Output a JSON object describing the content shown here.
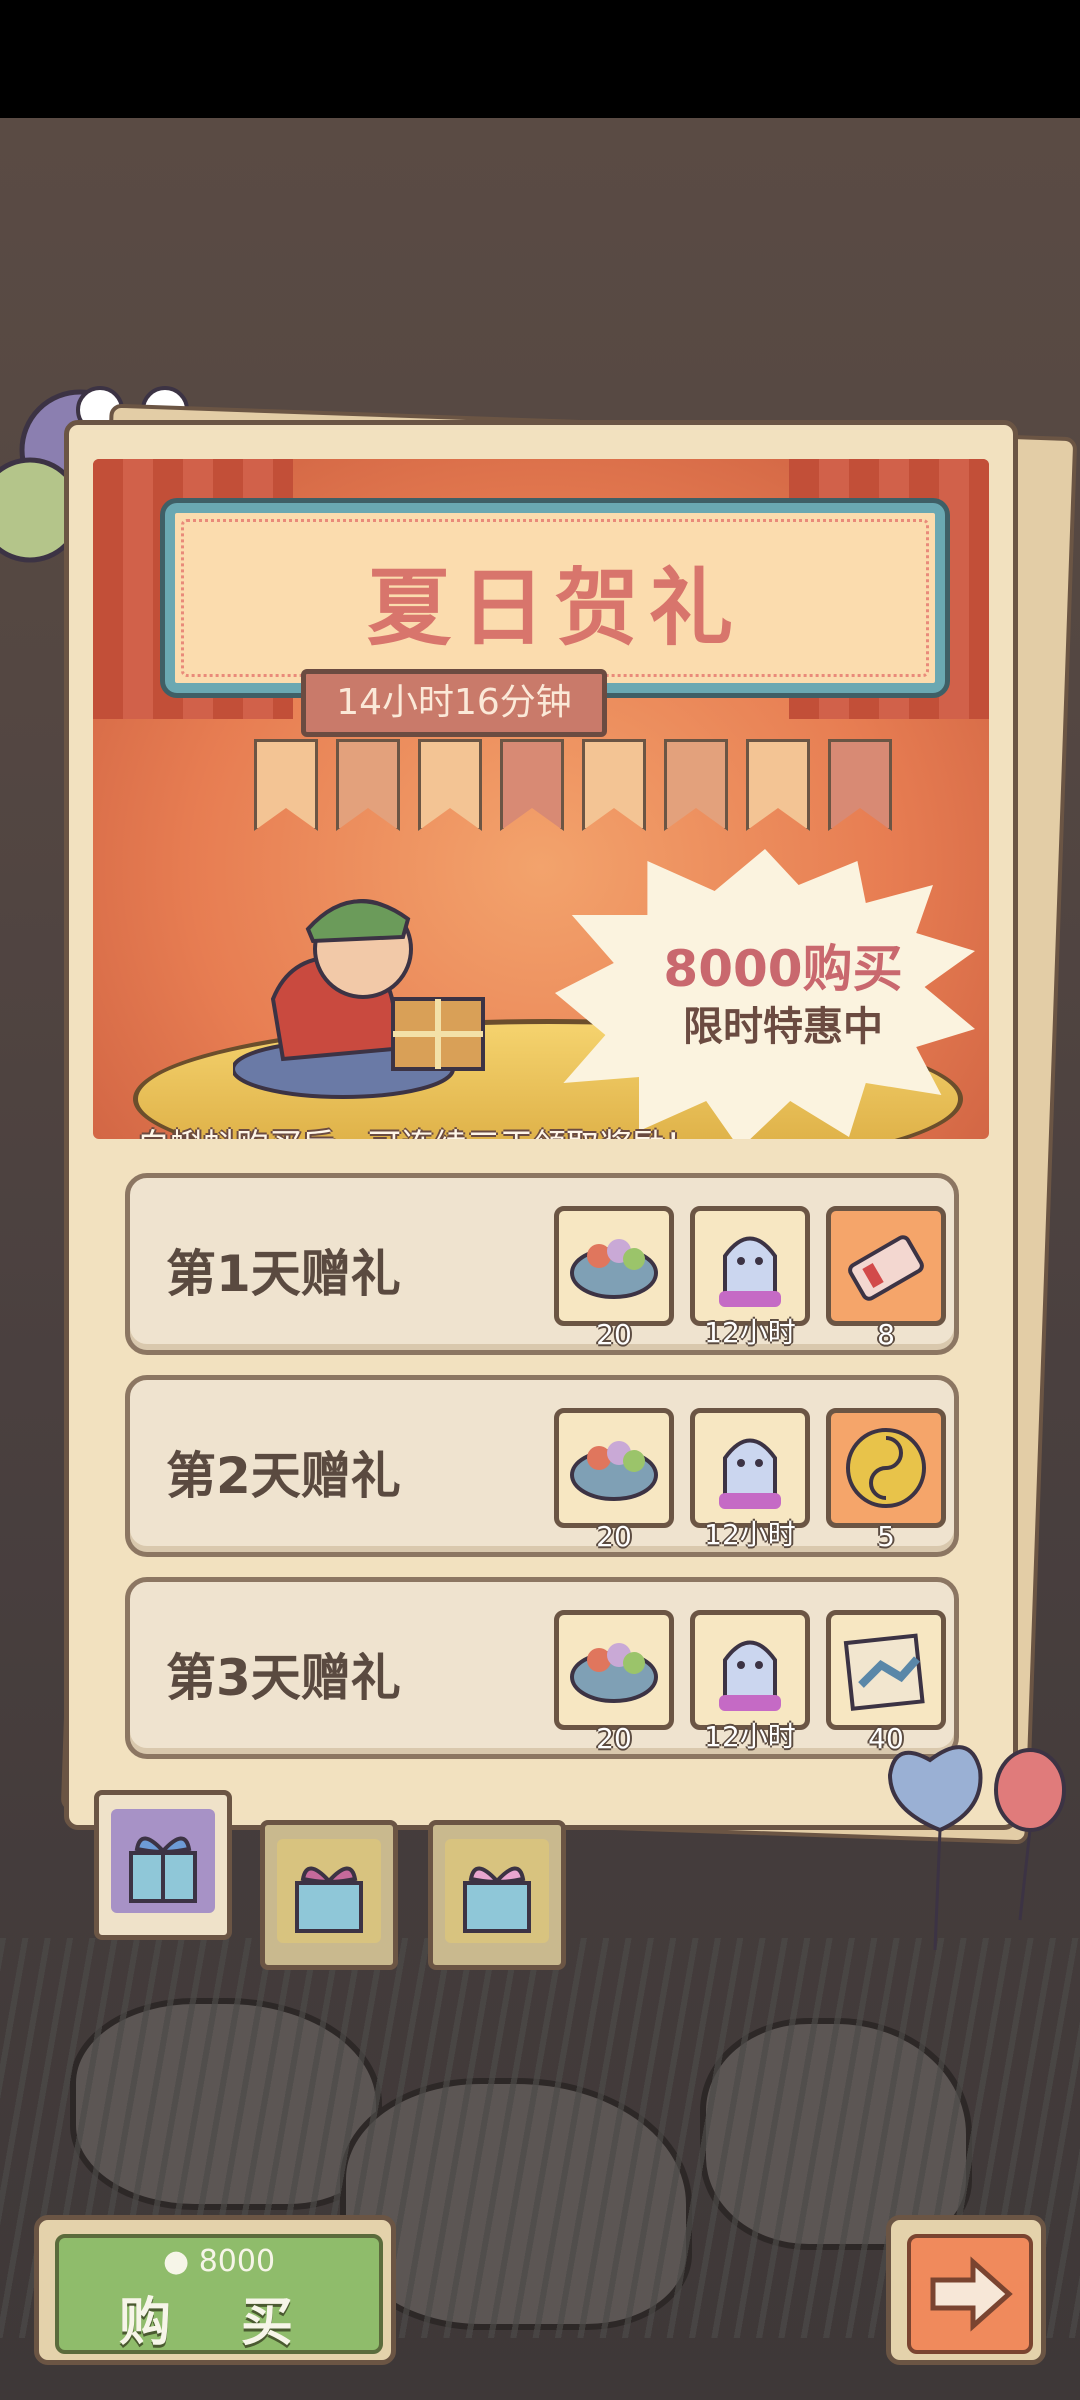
{
  "event": {
    "title": "夏日贺礼",
    "countdown": "14小时16分钟",
    "price_text": "8000购买",
    "promo_text": "限时特惠中",
    "tagline": "白蝌蚪购买后，可连续三天领取奖励！"
  },
  "rewards": [
    {
      "label": "第1天赠礼",
      "items": [
        {
          "icon": "candy-bowl-icon",
          "count": "20"
        },
        {
          "icon": "ghost-icon",
          "count": "12小时"
        },
        {
          "icon": "ticket-icon",
          "count": "8"
        }
      ]
    },
    {
      "label": "第2天赠礼",
      "items": [
        {
          "icon": "candy-bowl-icon",
          "count": "20"
        },
        {
          "icon": "ghost-icon",
          "count": "12小时"
        },
        {
          "icon": "yin-yang-coin-icon",
          "count": "5"
        }
      ]
    },
    {
      "label": "第3天赠礼",
      "items": [
        {
          "icon": "candy-bowl-icon",
          "count": "20"
        },
        {
          "icon": "ghost-icon",
          "count": "12小时"
        },
        {
          "icon": "map-scroll-icon",
          "count": "40"
        }
      ]
    }
  ],
  "buy_button": {
    "price": "8000",
    "label": "购 买"
  },
  "colors": {
    "accent": "#d8756c",
    "buy": "#8fbc6b",
    "next": "#f08a5c"
  }
}
